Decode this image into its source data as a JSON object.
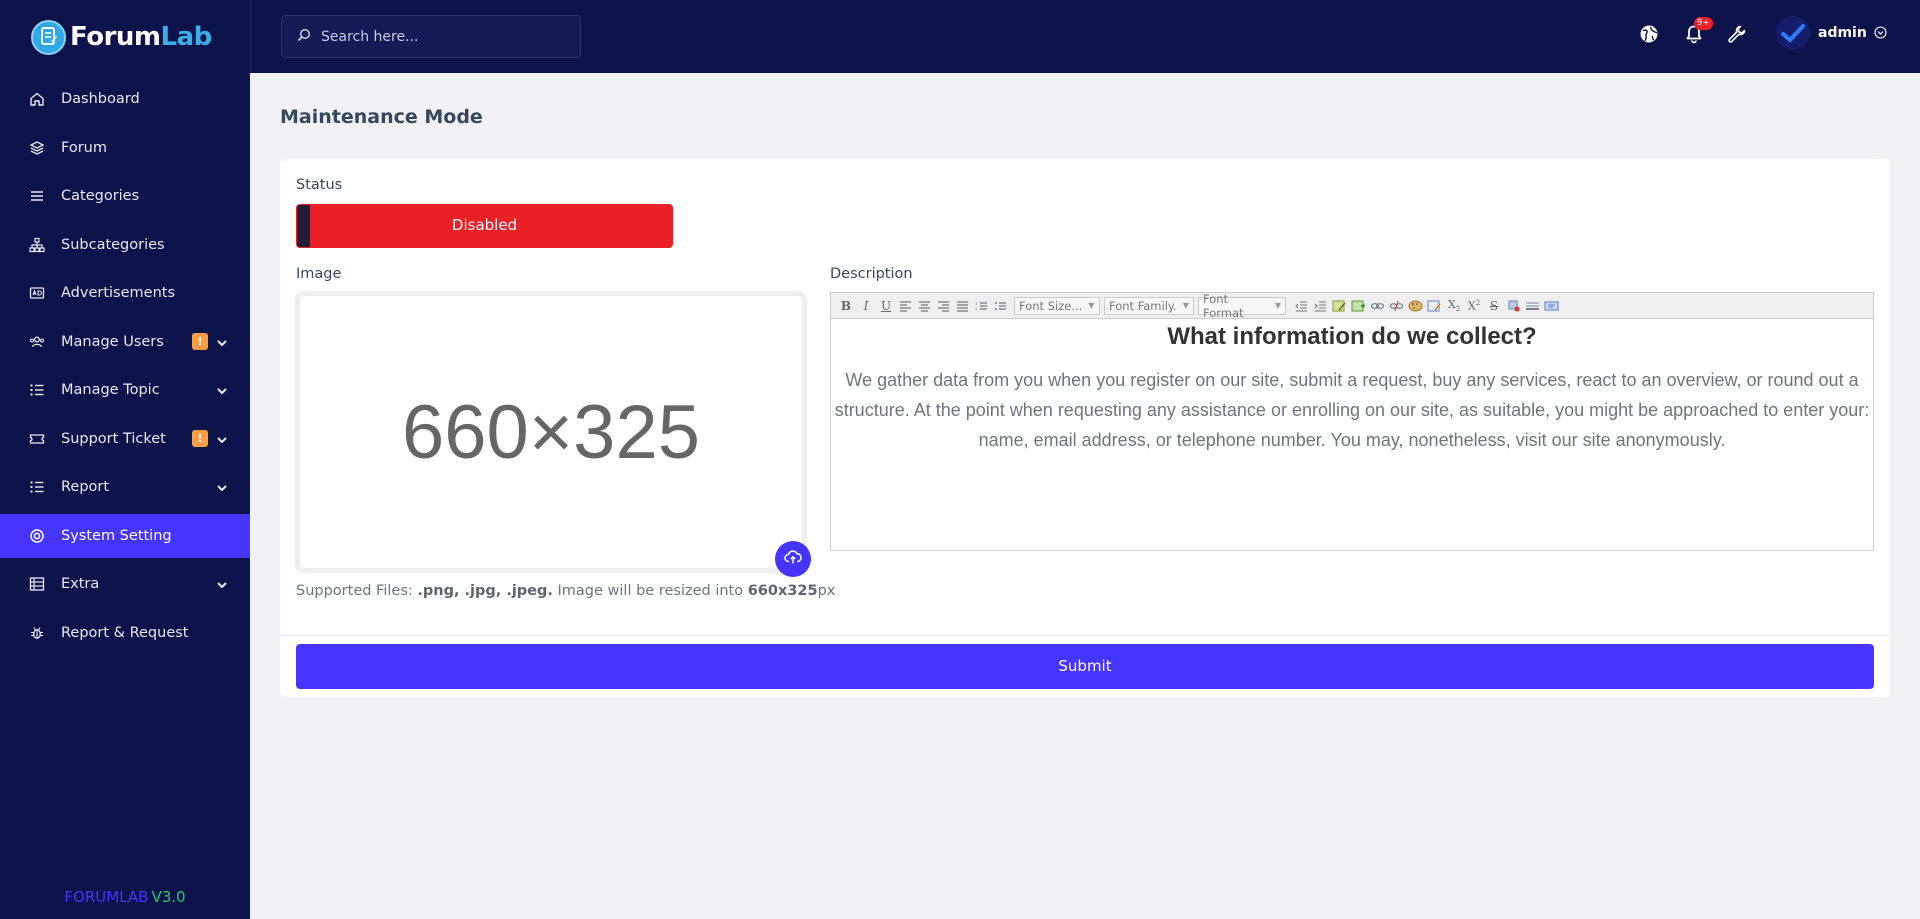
{
  "brand": {
    "name_part1": "Forum",
    "name_part2": "Lab",
    "icon": "forum-logo-icon"
  },
  "sidebar": {
    "items": [
      {
        "label": "Dashboard",
        "icon": "home-icon"
      },
      {
        "label": "Forum",
        "icon": "layers-icon"
      },
      {
        "label": "Categories",
        "icon": "menu-icon"
      },
      {
        "label": "Subcategories",
        "icon": "sitemap-icon"
      },
      {
        "label": "Advertisements",
        "icon": "ad-icon"
      },
      {
        "label": "Manage Users",
        "icon": "users-icon",
        "badge": "!",
        "expandable": true
      },
      {
        "label": "Manage Topic",
        "icon": "list-icon",
        "expandable": true
      },
      {
        "label": "Support Ticket",
        "icon": "ticket-icon",
        "badge": "!",
        "expandable": true
      },
      {
        "label": "Report",
        "icon": "list-icon",
        "expandable": true
      },
      {
        "label": "System Setting",
        "icon": "lifebuoy-icon",
        "active": true
      },
      {
        "label": "Extra",
        "icon": "server-icon",
        "expandable": true
      },
      {
        "label": "Report & Request",
        "icon": "bug-icon"
      }
    ],
    "version_name": "FORUMLAB",
    "version_number": "V3.0"
  },
  "topbar": {
    "search_placeholder": "Search here...",
    "notification_count": "9+",
    "admin_name": "admin",
    "icons": [
      "globe-icon",
      "bell-icon",
      "wrench-icon",
      "user-avatar",
      "chevron-circle-down-icon"
    ]
  },
  "page": {
    "title": "Maintenance Mode",
    "status_label": "Status",
    "status_value": "Disabled",
    "image_label": "Image",
    "image_placeholder": "660×325",
    "supported_prefix": "Supported Files: ",
    "supported_types": ".png, .jpg, .jpeg.",
    "supported_middle": " Image will be resized into ",
    "supported_size": "660x325",
    "supported_unit": "px",
    "description_label": "Description",
    "editor": {
      "font_size": "Font Size...",
      "font_family": "Font Family.",
      "font_format": "Font Format",
      "heading": "What information do we collect?",
      "body": "We gather data from you when you register on our site, submit a request, buy any services, react to an overview, or round out a structure. At the point when requesting any assistance or enrolling on our site, as suitable, you might be approached to enter your: name, email address, or telephone number. You may, nonetheless, visit our site anonymously."
    },
    "submit_label": "Submit"
  },
  "colors": {
    "sidebar_bg": "#0c124a",
    "accent": "#4634ff",
    "danger": "#ea2027",
    "warning": "#ff9f43",
    "success": "#28c76f",
    "page_bg": "#f1f1f6"
  }
}
